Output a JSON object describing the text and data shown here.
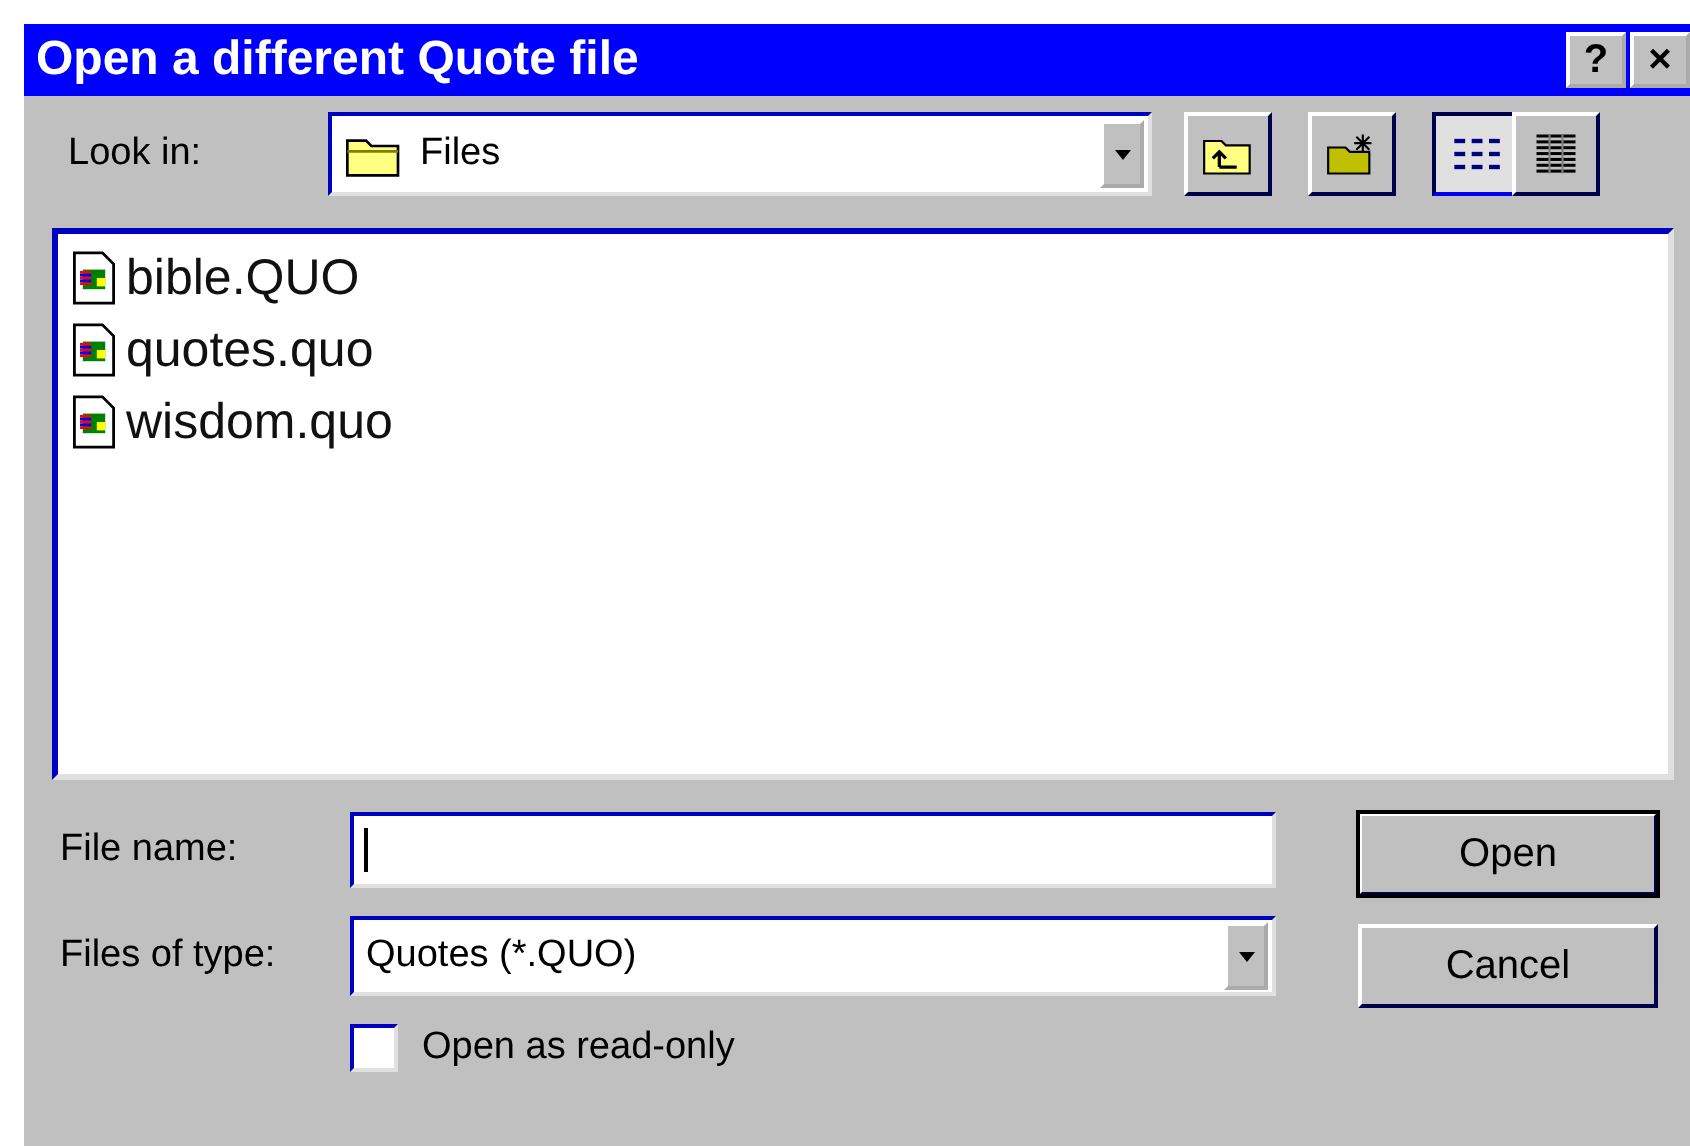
{
  "window": {
    "title": "Open a different Quote file",
    "help_label": "?",
    "close_label": "×"
  },
  "look_in": {
    "label": "Look in:",
    "value": "Files"
  },
  "toolbar": [
    {
      "kind": "up",
      "selected": false
    },
    {
      "kind": "new-folder",
      "selected": false
    },
    {
      "kind": "list",
      "selected": true
    },
    {
      "kind": "details",
      "selected": false
    }
  ],
  "files": [
    {
      "name": "bible.QUO"
    },
    {
      "name": "quotes.quo"
    },
    {
      "name": "wisdom.quo"
    }
  ],
  "file_name": {
    "label": "File name:"
  },
  "file_type": {
    "label": "Files of type:",
    "value": "Quotes (*.QUO)"
  },
  "read_only": {
    "label": "Open as read-only",
    "checked": false
  },
  "buttons": [
    {
      "label": "Open",
      "default": true
    },
    {
      "label": "Cancel",
      "default": false
    }
  ]
}
